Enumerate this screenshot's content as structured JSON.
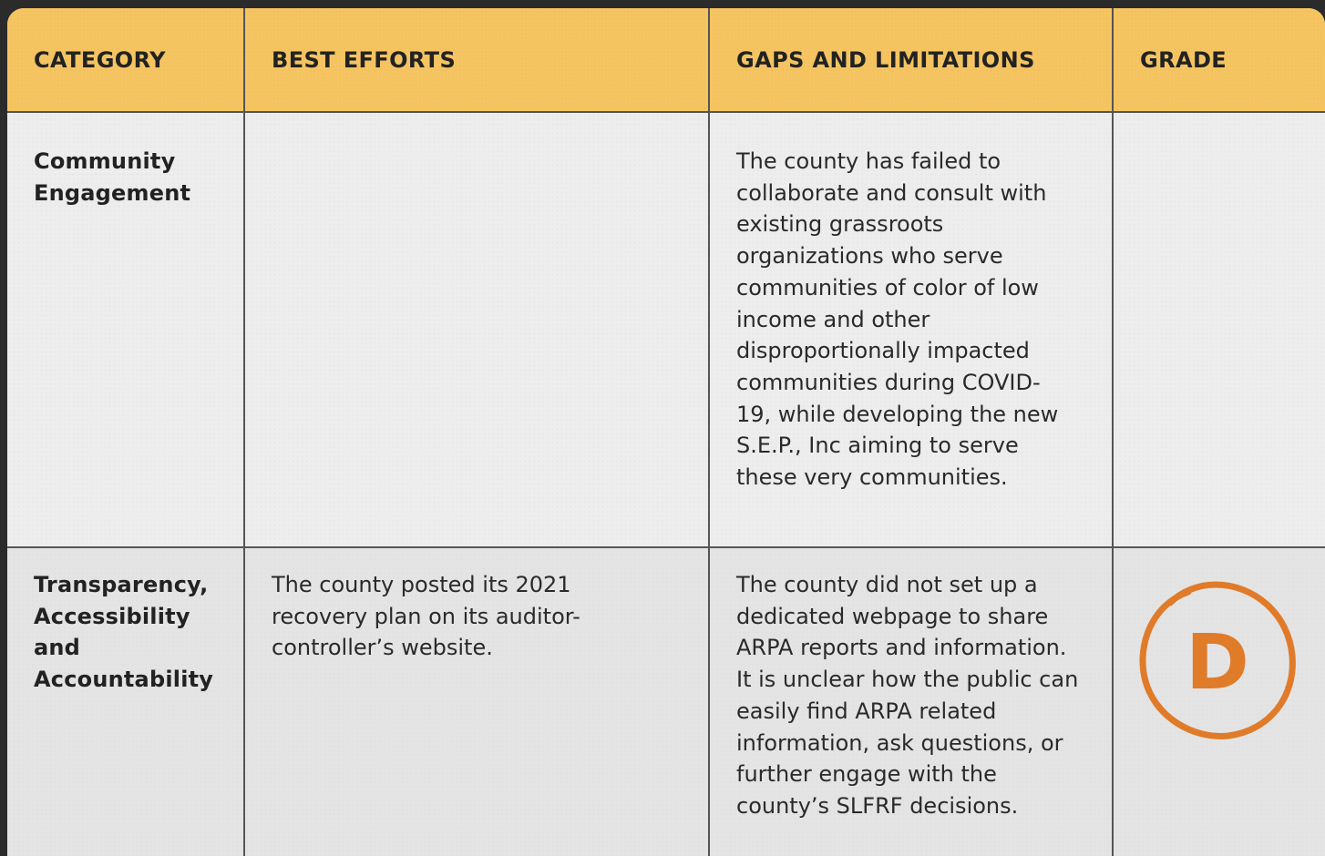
{
  "table": {
    "headers": {
      "category": "CATEGORY",
      "best_efforts": "BEST EFFORTS",
      "gaps": "GAPS AND LIMITATIONS",
      "grade": "GRADE"
    },
    "rows": [
      {
        "category": "Community Engagement",
        "best_efforts": "",
        "gaps": "The county has failed to collaborate and consult with existing grassroots organizations who serve communities of color of low income and other disproportionally impacted communities during COVID-19, while developing the new S.E.P., Inc aiming to serve these very communities.",
        "grade": ""
      },
      {
        "category": "Transparency, Accessibility and Accountability",
        "best_efforts": "The county posted its 2021 recovery plan on its auditor-controller’s website.",
        "gaps": "The county did not set up a dedicated webpage to share ARPA reports and information. It is unclear how the public can easily find ARPA related information, ask questions, or further engage with the county’s SLFRF decisions.",
        "grade": "D"
      }
    ]
  },
  "colors": {
    "header_bg": "#f4c35f",
    "grade_mark": "#e07b2a",
    "border": "#555555"
  }
}
